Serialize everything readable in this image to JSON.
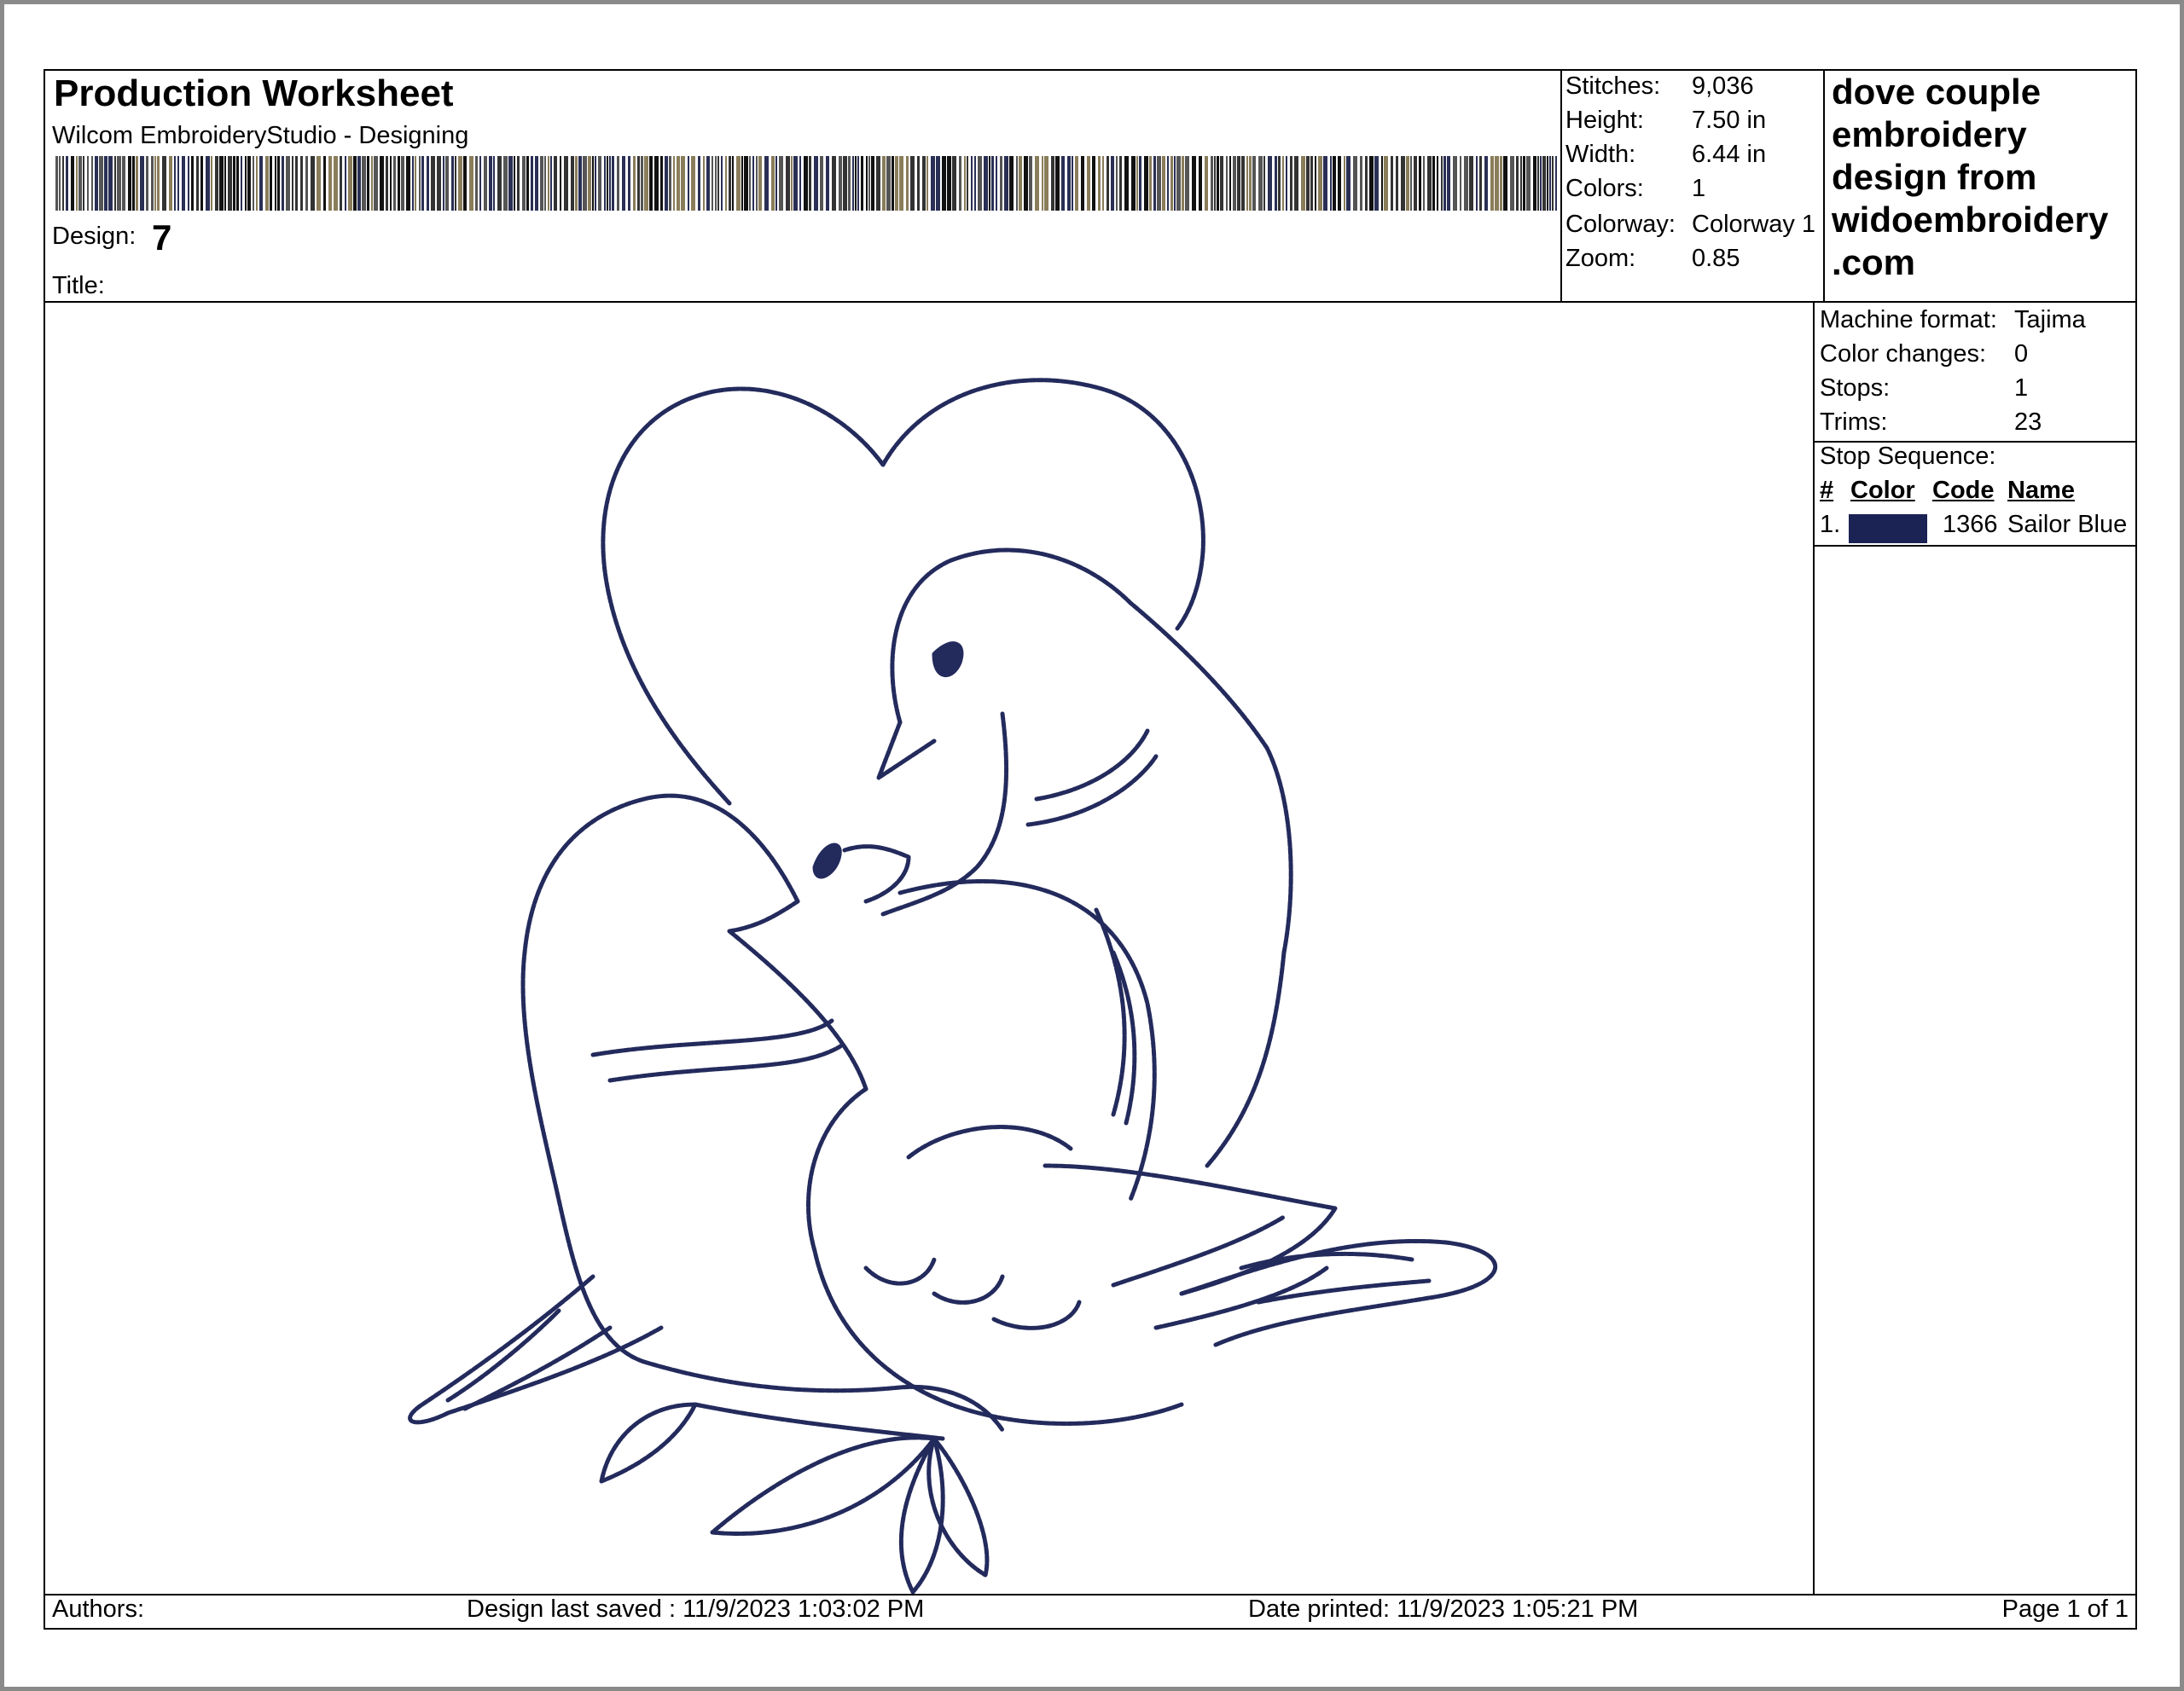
{
  "header": {
    "title": "Production Worksheet",
    "subtitle": "Wilcom EmbroideryStudio - Designing",
    "design_label": "Design:",
    "design_value": "7",
    "title_label": "Title:"
  },
  "stats": [
    {
      "label": "Stitches:",
      "value": "9,036"
    },
    {
      "label": "Height:",
      "value": "7.50 in"
    },
    {
      "label": "Width:",
      "value": "6.44 in"
    },
    {
      "label": "Colors:",
      "value": "1"
    },
    {
      "label": "Colorway:",
      "value": "Colorway 1"
    },
    {
      "label": "Zoom:",
      "value": "0.85"
    }
  ],
  "brand": {
    "text": "dove couple\nembroidery\ndesign from\nwidoembroidery\n.com"
  },
  "machine": [
    {
      "label": "Machine format:",
      "value": "Tajima"
    },
    {
      "label": "Color changes:",
      "value": "0"
    },
    {
      "label": "Stops:",
      "value": "1"
    },
    {
      "label": "Trims:",
      "value": "23"
    }
  ],
  "stop_sequence": {
    "label": "Stop Sequence:",
    "headers": [
      "#",
      "Color",
      "Code",
      "Name"
    ],
    "rows": [
      {
        "num": "1.",
        "code": "1366",
        "name": "Sailor Blue",
        "color": "#1b2254"
      }
    ]
  },
  "thread_color": "#232a5c",
  "footer": {
    "authors": "Authors:",
    "saved": "Design last saved : 11/9/2023 1:03:02 PM",
    "printed": "Date printed: 11/9/2023 1:05:21 PM",
    "page": "Page 1 of 1"
  }
}
